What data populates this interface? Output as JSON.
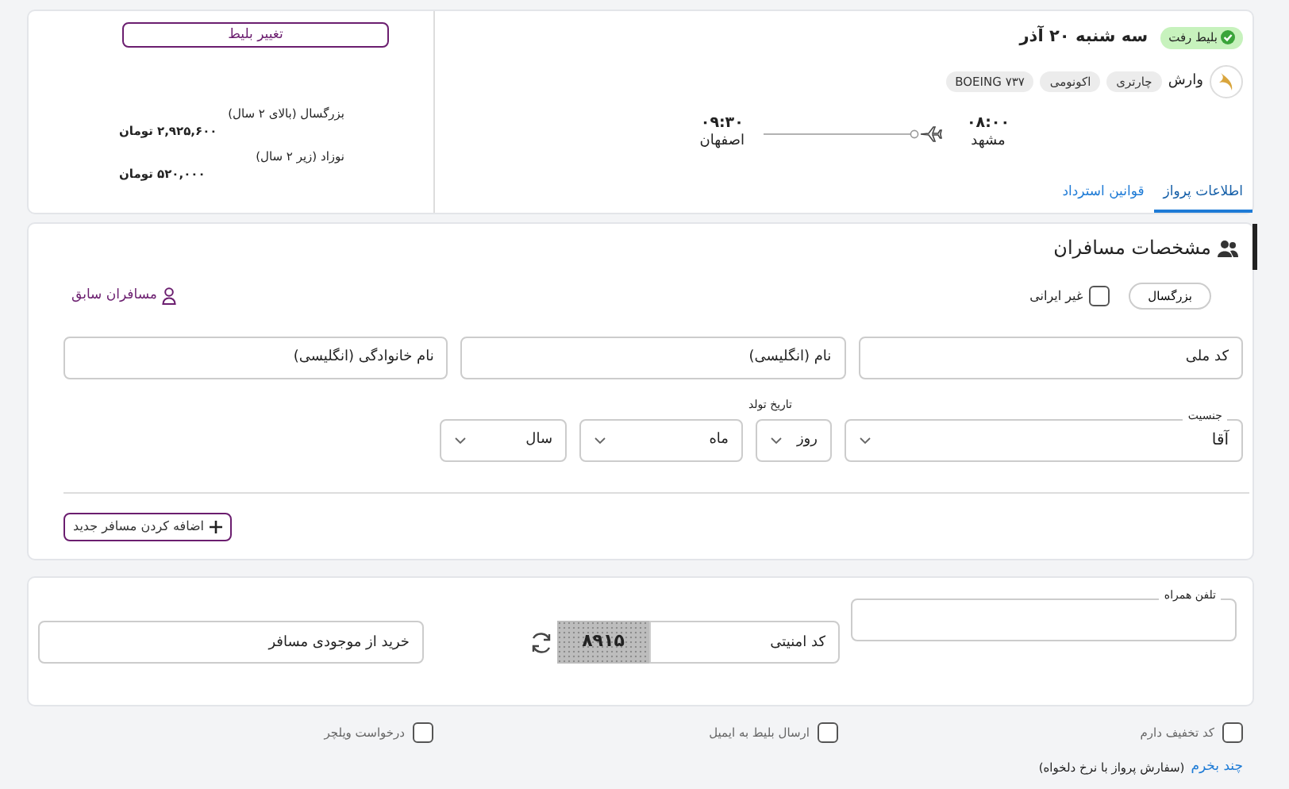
{
  "flight": {
    "badge": "بلیط رفت",
    "date": "سه شنبه ۲۰ آذر",
    "airline": "وارش",
    "tags": [
      "چارتری",
      "اکونومی",
      "BOEING ۷۳۷"
    ],
    "departure": {
      "time": "۰۸:۰۰",
      "city": "مشهد"
    },
    "arrival": {
      "time": "۰۹:۳۰",
      "city": "اصفهان"
    },
    "tabs": [
      {
        "label": "اطلاعات پرواز",
        "selected": true
      },
      {
        "label": "قوانین استرداد",
        "selected": false
      }
    ]
  },
  "price": {
    "change_button": "تغییر بلیط",
    "fares": [
      {
        "label": "بزرگسال (بالای ۲ سال)",
        "amount": "۲,۹۲۵,۶۰۰ تومان"
      },
      {
        "label": "نوزاد (زیر ۲ سال)",
        "amount": "۵۲۰,۰۰۰ تومان"
      }
    ]
  },
  "passengers": {
    "title": "مشخصات مسافران",
    "type_pill": "بزرگسال",
    "non_iranian": {
      "label": "غیر ایرانی",
      "checked": false
    },
    "previous_link": "مسافران سابق",
    "fields": [
      {
        "placeholder": "کد ملی"
      },
      {
        "placeholder": "نام (انگلیسی)"
      },
      {
        "placeholder": "نام خانوادگی (انگلیسی)"
      }
    ],
    "gender": {
      "label": "جنسیت",
      "value": "آقا"
    },
    "birth_label": "تاریخ تولد",
    "birth_selects": [
      {
        "value": "روز"
      },
      {
        "value": "ماه"
      },
      {
        "value": "سال"
      }
    ],
    "add_button": "اضافه کردن مسافر جدید"
  },
  "contact": {
    "phone_label": "تلفن همراه",
    "captcha_placeholder": "کد امنیتی",
    "captcha_code": "۸۹۱۵",
    "wallet_placeholder": "خرید از موجودی مسافر"
  },
  "options": [
    {
      "label": "کد تخفیف دارم",
      "checked": false
    },
    {
      "label": "ارسال بلیط به ایمیل",
      "checked": false
    },
    {
      "label": "درخواست ویلچر",
      "checked": false
    }
  ],
  "footer": {
    "link": "چند بخرم",
    "note": "(سفارش پرواز با نرخ دلخواه)"
  }
}
